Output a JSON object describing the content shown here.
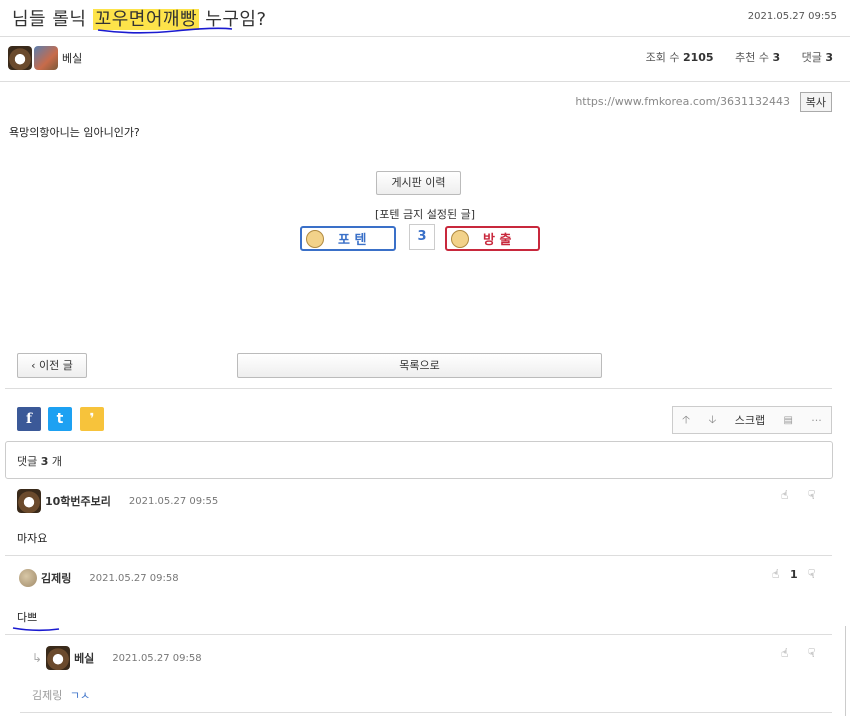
{
  "post": {
    "title_pre": "님들 롤닉 ",
    "title_highlight": "꼬우면어깨빵",
    "title_post": " 누구임?",
    "date": "2021.05.27 09:55",
    "author": "베실",
    "views_label": "조회 수",
    "views": "2105",
    "recommend_label": "추천 수",
    "recommend": "3",
    "comments_label": "댓글",
    "comments": "3",
    "url": "https://www.fmkorea.com/3631132443",
    "copy_label": "복사",
    "body": "욕망의항아니는 임아니인가?"
  },
  "board_history_label": "게시판 이력",
  "potent_notice": "[포텐 금지 설정된 글]",
  "potent_label": "포 텐",
  "vote_count": "3",
  "ban_label": "방 출",
  "nav": {
    "prev_label": "이전 글",
    "list_label": "목록으로"
  },
  "social": {
    "facebook": "f",
    "twitter": "t",
    "kakao": "❜"
  },
  "toolbox": {
    "scrap_label": "스크랩"
  },
  "comment_header": {
    "prefix": "댓글",
    "count": "3",
    "suffix": "개"
  },
  "comments": [
    {
      "name": "10학번주보리",
      "date": "2021.05.27 09:55",
      "text": "마자요",
      "likes": ""
    },
    {
      "name": "김제링",
      "date": "2021.05.27 09:58",
      "text": "다쁘",
      "likes": "1"
    },
    {
      "name": "베실",
      "date": "2021.05.27 09:58",
      "reply_to": "김제링",
      "text": "ㄱㅅ",
      "likes": ""
    }
  ],
  "colors": {
    "highlight": "#fde34a",
    "potent": "#3a70c8",
    "ban": "#c8283c",
    "annotation_pen": "#1a1ad0"
  }
}
